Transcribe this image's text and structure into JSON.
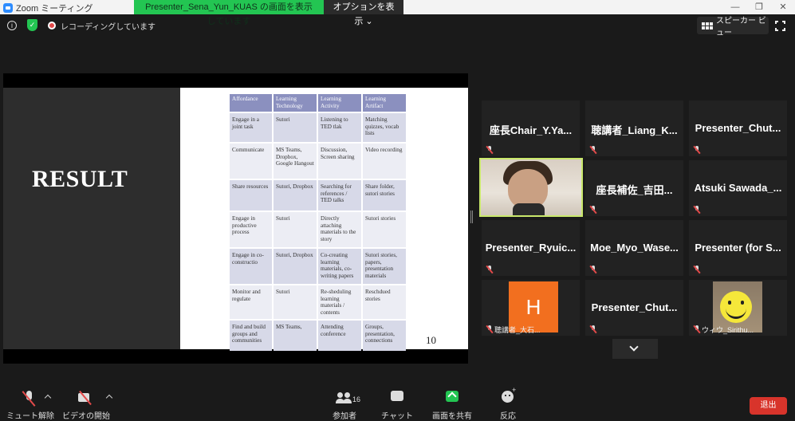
{
  "window": {
    "title": "Zoom ミーティング",
    "share_banner": "Presenter_Sena_Yun_KUAS の画面を表示しています",
    "options_label": "オプションを表示 ⌄"
  },
  "info": {
    "recording_label": "レコーディングしています",
    "speaker_view_label": "スピーカー ビュー"
  },
  "slide": {
    "title": "RESULT",
    "page_number": "10",
    "headers": [
      "Affordance",
      "Learning Technology",
      "Learning Activity",
      "Learning Artifact"
    ],
    "rows": [
      [
        "Engage in a joint task",
        "Sutori",
        "Listening to TED tlak",
        "Matching quizzes, vocab lists"
      ],
      [
        "Communicate",
        "MS Teams, Dropbox, Google Hangout",
        "Discussion, Screen sharing",
        "Video recording"
      ],
      [
        "Share resources",
        "Sutori, Dropbox",
        "Searching for references / TED talks",
        "Share folder, sutori stories"
      ],
      [
        "Engage in productive process",
        "Sutori",
        "Directly attaching materials to the story",
        "Sutori stories"
      ],
      [
        "Engage in co-constructio",
        "Sutori, Dropbox",
        "Co-creating learning materials, co-writing papers",
        "Sutori stories, papers, presentation materials"
      ],
      [
        "Monitor and regulate",
        "Sutori",
        "Re-sheduling learning materials / contents",
        "Reschdued stories"
      ],
      [
        "Find and build groups and communities",
        "MS Teams,",
        "Attending conference",
        "Groups, presentation, connections"
      ]
    ]
  },
  "participants": [
    {
      "name": "座長Chair_Y.Ya..."
    },
    {
      "name": "聴講者_Liang_K..."
    },
    {
      "name": "Presenter_Chut..."
    },
    {
      "name": ""
    },
    {
      "name": "座長補佐_吉田..."
    },
    {
      "name": "Atsuki Sawada_..."
    },
    {
      "name": "Presenter_Ryuic..."
    },
    {
      "name": "Moe_Myo_Wase..."
    },
    {
      "name": "Presenter (for S..."
    },
    {
      "name": "聴講者_大石...",
      "avatar_letter": "H"
    },
    {
      "name": "Presenter_Chut..."
    },
    {
      "name": "ウィウ_Sirithu..."
    }
  ],
  "toolbar": {
    "mute_label": "ミュート解除",
    "video_label": "ビデオの開始",
    "participants_label": "参加者",
    "participants_count": "16",
    "chat_label": "チャット",
    "share_label": "画面を共有",
    "react_label": "反応",
    "leave_label": "退出"
  },
  "colors": {
    "share_green": "#23c552",
    "leave_red": "#d8342b",
    "table_header": "#8b90bf",
    "avatar_orange": "#f26f1f",
    "active_speaker_border": "#c9e86b"
  }
}
